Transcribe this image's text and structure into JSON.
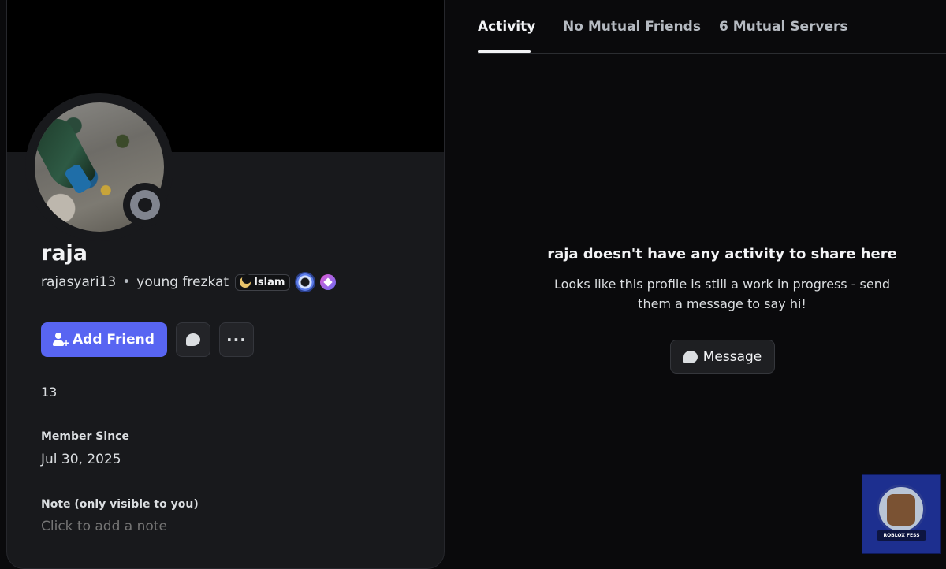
{
  "profile": {
    "display_name": "raja",
    "username": "rajasyari13",
    "separator": "•",
    "pronouns_status": "young frezkat",
    "guild_tag": "Islam",
    "add_friend_label": "Add Friend",
    "more_label": "···",
    "age": "13",
    "member_since_label": "Member Since",
    "member_since_value": "Jul 30, 2025",
    "note_label": "Note (only visible to you)",
    "note_placeholder": "Click to add a note"
  },
  "tabs": [
    {
      "label": "Activity",
      "active": true
    },
    {
      "label": "No Mutual Friends",
      "active": false
    },
    {
      "label": "6 Mutual Servers",
      "active": false
    }
  ],
  "empty_state": {
    "title": "raja doesn't have any activity to share here",
    "text": "Looks like this profile is still a work in progress - send them a message to say hi!",
    "message_button": "Message"
  },
  "watermark": {
    "text": "ROBLOX FESS"
  },
  "colors": {
    "accent": "#5865f2",
    "status_offline": "#80848e",
    "background": "#0a0a0c",
    "card": "#18191c"
  },
  "icons": {
    "add_friend": "person-add-icon",
    "dm": "chat-bubble-icon",
    "more": "more-dots-icon",
    "message": "chat-bubble-icon",
    "guild_tag": "moon-icon"
  }
}
